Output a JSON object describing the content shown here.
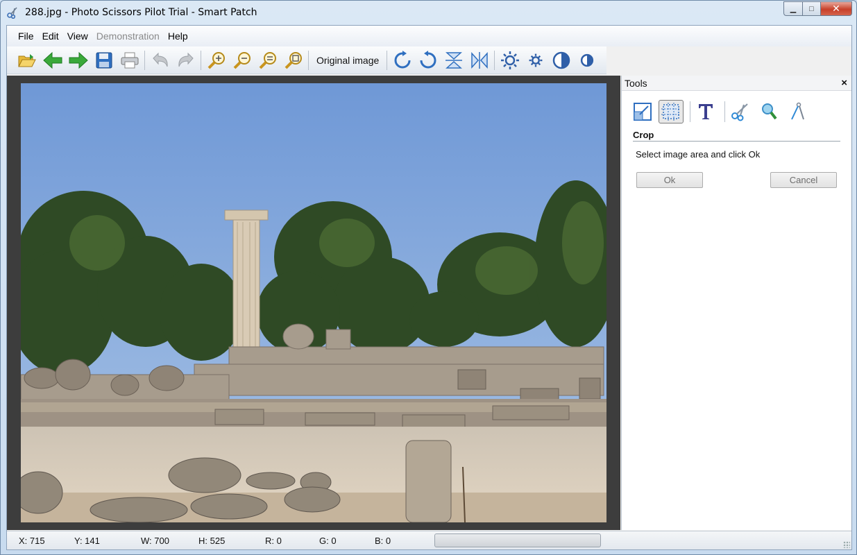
{
  "window": {
    "title": "288.jpg - Photo Scissors Pilot Trial - Smart Patch",
    "controls": {
      "minimize": "▁",
      "maximize": "□",
      "close": "✕"
    }
  },
  "menu": {
    "items": [
      {
        "label": "File",
        "enabled": true
      },
      {
        "label": "Edit",
        "enabled": true
      },
      {
        "label": "View",
        "enabled": true
      },
      {
        "label": "Demonstration",
        "enabled": false
      },
      {
        "label": "Help",
        "enabled": true
      }
    ]
  },
  "toolbar": {
    "original_image_label": "Original image",
    "icons": [
      "open-folder-icon",
      "back-arrow-icon",
      "forward-arrow-icon",
      "save-icon",
      "print-icon",
      "undo-icon",
      "redo-icon",
      "zoom-in-icon",
      "zoom-out-icon",
      "zoom-fit-icon",
      "zoom-actual-icon",
      "rotate-clockwise-icon",
      "rotate-counterclockwise-icon",
      "flip-vertical-icon",
      "flip-horizontal-icon",
      "brightness-up-icon",
      "brightness-down-icon",
      "contrast-up-icon",
      "contrast-down-icon"
    ]
  },
  "tools_panel": {
    "title": "Tools",
    "close": "×",
    "icons": [
      "resize-icon",
      "crop-icon",
      "text-icon",
      "scissors-icon",
      "magnifier-icon",
      "compass-icon"
    ],
    "active_tool": "crop-icon",
    "section_title": "Crop",
    "hint": "Select image area and click Ok",
    "ok_label": "Ok",
    "cancel_label": "Cancel"
  },
  "status": {
    "x": "X: 715",
    "y": "Y: 141",
    "w": "W: 700",
    "h": "H: 525",
    "r": "R: 0",
    "g": "G: 0",
    "b": "B: 0",
    "progress": 0
  },
  "colors": {
    "canvas_bg": "#3d3d3d",
    "sky": "#7fa6d8",
    "accent_blue": "#2f6fc0",
    "green_arrow": "#3aa93a"
  }
}
